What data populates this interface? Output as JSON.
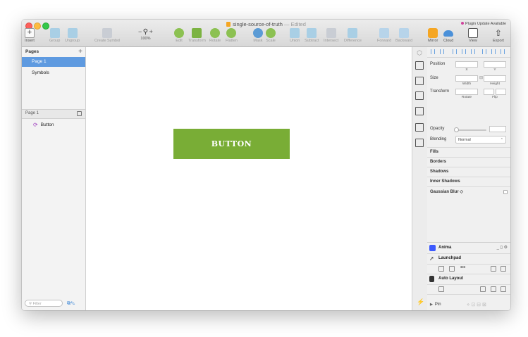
{
  "window": {
    "title": "single-source-of-truth",
    "title_status": "— Edited",
    "plugin_badge": "Plugin Update Available"
  },
  "toolbar": {
    "insert": "Insert",
    "group": "Group",
    "ungroup": "Ungroup",
    "create_symbol": "Create Symbol",
    "zoom_minus": "−",
    "zoom_plus": "+",
    "zoom_level": "100%",
    "edit": "Edit",
    "transform": "Transform",
    "rotate": "Rotate",
    "flatten": "Flatten",
    "mask": "Mask",
    "scale": "Scale",
    "union": "Union",
    "subtract": "Subtract",
    "intersect": "Intersect",
    "difference": "Difference",
    "forward": "Forward",
    "backward": "Backward",
    "mirror": "Mirror",
    "cloud": "Cloud",
    "view": "View",
    "export": "Export"
  },
  "sidebar": {
    "pages_header": "Pages",
    "pages": [
      {
        "label": "Page 1",
        "selected": true
      },
      {
        "label": "Symbols",
        "selected": false
      }
    ],
    "layer_header": "Page 1",
    "layers": [
      {
        "label": "Button",
        "icon": "symbol-icon"
      }
    ],
    "filter_placeholder": "Filter"
  },
  "canvas": {
    "button_text": "BUTTON",
    "button_color": "#79ad36"
  },
  "inspector": {
    "position": "Position",
    "x": "X",
    "y": "Y",
    "size": "Size",
    "width": "Width",
    "height": "Height",
    "transform": "Transform",
    "rotate": "Rotate",
    "flip": "Flip",
    "opacity": "Opacity",
    "blending": "Blending",
    "blending_value": "Normal",
    "sections": [
      "Fills",
      "Borders",
      "Shadows",
      "Inner Shadows",
      "Gaussian Blur ◇"
    ]
  },
  "plugins": {
    "anima": "Anima",
    "launchpad": "Launchpad",
    "auto_layout": "Auto Layout",
    "pin": "Pin"
  }
}
